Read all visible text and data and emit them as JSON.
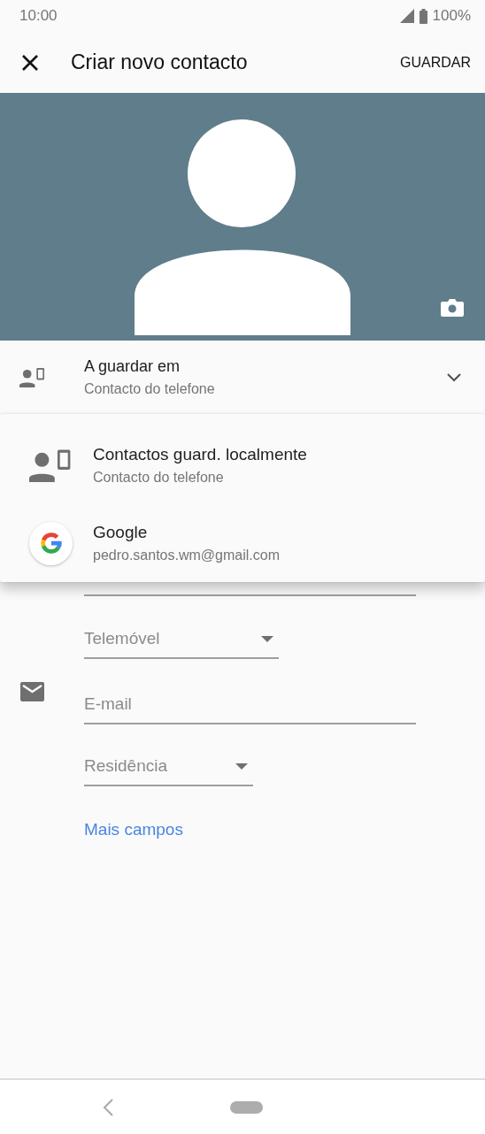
{
  "status_bar": {
    "time": "10:00",
    "battery": "100%"
  },
  "app_bar": {
    "title": "Criar novo contacto",
    "action": "GUARDAR"
  },
  "account": {
    "label": "A guardar em",
    "value": "Contacto do telefone",
    "expanded": true
  },
  "account_menu": [
    {
      "kind": "device",
      "title": "Contactos guard. localmente",
      "subtitle": "Contacto do telefone"
    },
    {
      "kind": "google",
      "title": "Google",
      "subtitle": "pedro.santos.wm@gmail.com"
    }
  ],
  "form": [
    {
      "kind": "select",
      "value": "Telemóvel"
    },
    {
      "kind": "email",
      "placeholder": "E-mail"
    },
    {
      "kind": "select",
      "value": "Residência"
    }
  ],
  "more_fields": "Mais campos"
}
